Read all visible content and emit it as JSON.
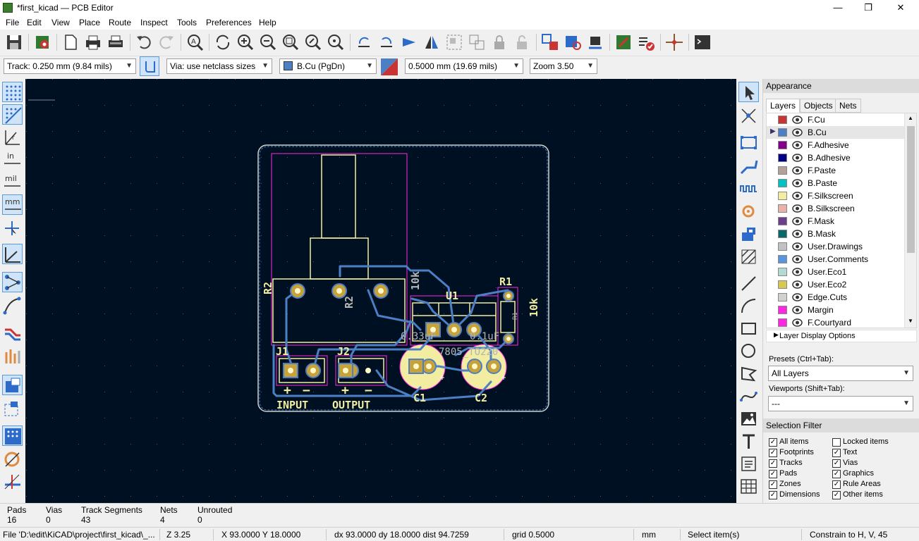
{
  "window": {
    "title": "*first_kicad — PCB Editor",
    "minimize": "—",
    "maximize": "❐",
    "close": "✕"
  },
  "menu": [
    "File",
    "Edit",
    "View",
    "Place",
    "Route",
    "Inspect",
    "Tools",
    "Preferences",
    "Help"
  ],
  "toolbar2": {
    "track": "Track: 0.250 mm (9.84 mils)",
    "via": "Via: use netclass sizes",
    "layer": "B.Cu (PgDn)",
    "layer_color": "#4d7fc4",
    "grid": "0.5000 mm (19.69 mils)",
    "zoom": "Zoom 3.50"
  },
  "pcb": {
    "labels": {
      "r2_ref": "R2",
      "r2_value": "R2",
      "r2_value_right": "10k",
      "u1": "U1",
      "u1_value": "7805_TO220",
      "c1_value": "0.33uF",
      "c2_value": "0.1uF",
      "r1": "R1",
      "r1_pad": "R1",
      "r1_value": "10k",
      "j1": "J1",
      "j2": "J2",
      "plus1": "+",
      "minus1": "−",
      "plus2": "+",
      "minus2": "−",
      "input": "INPUT",
      "output": "OUTPUT",
      "c1": "C1",
      "c2": "C2"
    }
  },
  "appearance": {
    "header": "Appearance",
    "tabs": [
      "Layers",
      "Objects",
      "Nets"
    ],
    "layers": [
      {
        "name": "F.Cu",
        "color": "#c83434"
      },
      {
        "name": "B.Cu",
        "color": "#4d7fc4",
        "selected": true
      },
      {
        "name": "F.Adhesive",
        "color": "#84008a"
      },
      {
        "name": "B.Adhesive",
        "color": "#000084"
      },
      {
        "name": "F.Paste",
        "color": "#b4a09a"
      },
      {
        "name": "B.Paste",
        "color": "#00c2c2"
      },
      {
        "name": "F.Silkscreen",
        "color": "#f2eda1"
      },
      {
        "name": "B.Silkscreen",
        "color": "#e8b2a7"
      },
      {
        "name": "F.Mask",
        "color": "#6b3f8a"
      },
      {
        "name": "B.Mask",
        "color": "#066a6a"
      },
      {
        "name": "User.Drawings",
        "color": "#c2c2c2"
      },
      {
        "name": "User.Comments",
        "color": "#5994dc"
      },
      {
        "name": "User.Eco1",
        "color": "#b4dbd2"
      },
      {
        "name": "User.Eco2",
        "color": "#d8c852"
      },
      {
        "name": "Edge.Cuts",
        "color": "#d0d2cd"
      },
      {
        "name": "Margin",
        "color": "#ff26e2"
      },
      {
        "name": "F.Courtyard",
        "color": "#ff26e2"
      }
    ],
    "layer_display_options": "Layer Display Options",
    "presets_label": "Presets (Ctrl+Tab):",
    "presets_value": "All Layers",
    "viewports_label": "Viewports (Shift+Tab):",
    "viewports_value": "---"
  },
  "selection_filter": {
    "header": "Selection Filter",
    "items": [
      {
        "label": "All items",
        "checked": true
      },
      {
        "label": "Locked items",
        "checked": false
      },
      {
        "label": "Footprints",
        "checked": true
      },
      {
        "label": "Text",
        "checked": true
      },
      {
        "label": "Tracks",
        "checked": true
      },
      {
        "label": "Vias",
        "checked": true
      },
      {
        "label": "Pads",
        "checked": true
      },
      {
        "label": "Graphics",
        "checked": true
      },
      {
        "label": "Zones",
        "checked": true
      },
      {
        "label": "Rule Areas",
        "checked": true
      },
      {
        "label": "Dimensions",
        "checked": true
      },
      {
        "label": "Other items",
        "checked": true
      }
    ]
  },
  "msgpanel": [
    {
      "title": "Pads",
      "value": "16"
    },
    {
      "title": "Vias",
      "value": "0"
    },
    {
      "title": "Track Segments",
      "value": "43"
    },
    {
      "title": "Nets",
      "value": "4"
    },
    {
      "title": "Unrouted",
      "value": "0"
    }
  ],
  "status": {
    "file": "File 'D:\\edit\\KiCAD\\project\\first_kicad\\_...",
    "zoom": "Z 3.25",
    "xy": "X 93.0000  Y 18.0000",
    "delta": "dx 93.0000  dy 18.0000  dist 94.7259",
    "grid": "grid 0.5000",
    "units": "mm",
    "mode": "Select item(s)",
    "constrain": "Constrain to H, V, 45"
  }
}
